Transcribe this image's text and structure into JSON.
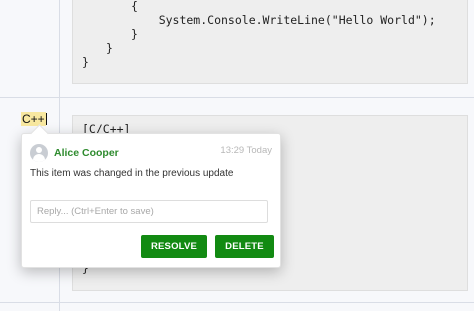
{
  "code_block_top": {
    "lines": [
      "{",
      "    System.Console.WriteLine(\"Hello World\");",
      "}",
      "}",
      "}"
    ]
  },
  "code_block_bottom": {
    "first_line": "[C/C++]",
    "last_line": "}"
  },
  "row_label": "C++",
  "comment": {
    "author": "Alice Cooper",
    "time": "13:29 Today",
    "message": "This item was changed in the previous update",
    "reply_placeholder": "Reply... (Ctrl+Enter to save)",
    "resolve_label": "RESOLVE",
    "delete_label": "DELETE"
  },
  "colors": {
    "accent_green": "#128a12",
    "author_green": "#2e8b2e",
    "highlight": "#f8e8a0"
  }
}
